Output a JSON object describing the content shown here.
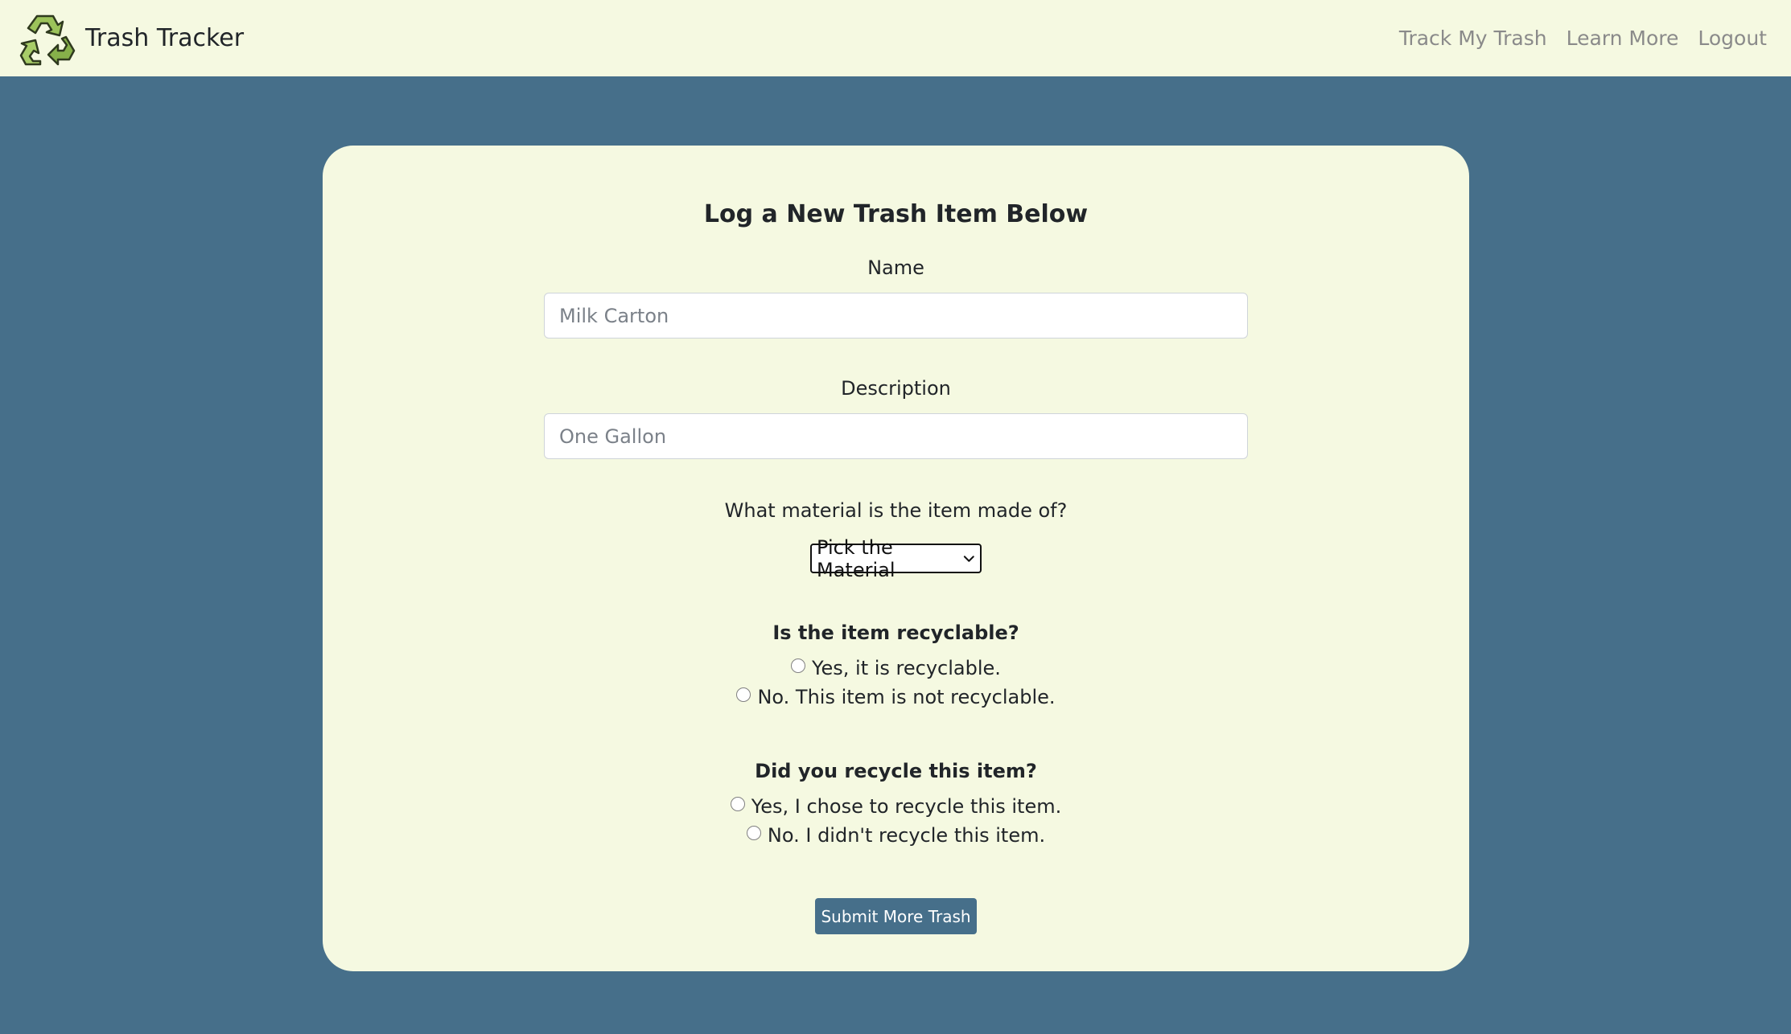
{
  "navbar": {
    "brand_name": "Trash Tracker",
    "logo_icon": "recycle-icon",
    "links": [
      "Track My Trash",
      "Learn More",
      "Logout"
    ]
  },
  "form": {
    "title": "Log a New Trash Item Below",
    "name_label": "Name",
    "name_placeholder": "Milk Carton",
    "description_label": "Description",
    "description_placeholder": "One Gallon",
    "material_label": "What material is the item made of?",
    "material_selected": "Pick the Material",
    "recyclable_question": "Is the item recyclable?",
    "recyclable_options": [
      "Yes, it is recyclable.",
      "No. This item is not recyclable."
    ],
    "recycled_question": "Did you recycle this item?",
    "recycled_options": [
      "Yes, I chose to recycle this item.",
      "No. I didn't recycle this item."
    ],
    "submit_label": "Submit More Trash"
  },
  "colors": {
    "page_background": "#466f8a",
    "panel_background": "#f5f9e1",
    "button_background": "#466f8a",
    "logo_green": "#9cc35a"
  }
}
